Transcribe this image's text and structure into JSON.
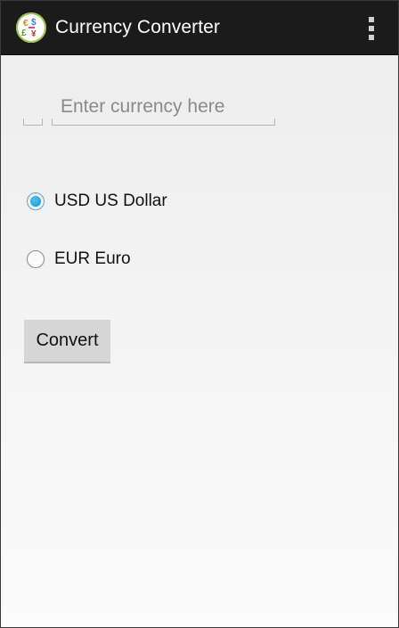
{
  "action_bar": {
    "title": "Currency Converter",
    "app_icon": "currency-exchange-logo",
    "overflow_icon": "vertical-dots-icon",
    "background_color": "#1b1b1b"
  },
  "form": {
    "currency_input": {
      "value": "",
      "placeholder": "Enter currency here"
    },
    "options": [
      {
        "label": "USD US Dollar",
        "checked": true
      },
      {
        "label": "EUR Euro",
        "checked": false
      }
    ],
    "convert_label": "Convert"
  },
  "colors": {
    "radio_accent": "#2aa4da",
    "button_bg": "#d6d6d6"
  }
}
